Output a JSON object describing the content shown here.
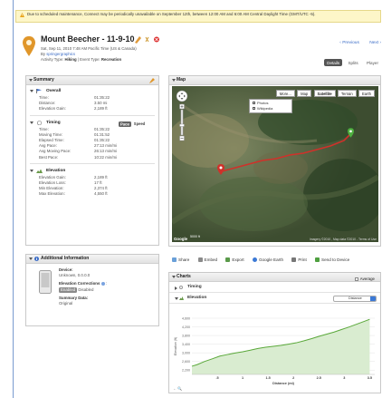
{
  "notice": "Due to scheduled maintenance, Connect may be periodically unavailable on September 12th, between 12:00 AM and 6:00 AM Central Daylight Time (GMT/UTC -5).",
  "activity": {
    "title": "Mount Beecher - 11-9-10",
    "date": "Sat, Sep 11, 2010 7:48 AM Pacific Time (US & Canada)",
    "by_label": "By",
    "by_user": "springergraphics",
    "type_label": "Activity Type:",
    "type_value": "Hiking",
    "event_label": "Event Type:",
    "event_value": "Recreation"
  },
  "nav": {
    "previous": "‹ Previous",
    "next": "Next ›"
  },
  "tabs": [
    "Details",
    "Splits",
    "Player"
  ],
  "summary": {
    "title": "Summary",
    "overall": {
      "title": "Overall",
      "rows": [
        {
          "k": "Time:",
          "v": "01:35:22"
        },
        {
          "k": "Distance:",
          "v": "3.50 mi"
        },
        {
          "k": "Elevation Gain:",
          "v": "2,189 ft"
        }
      ]
    },
    "timing": {
      "title": "Timing",
      "toggle_on": "Pace",
      "toggle_off": "Speed",
      "rows": [
        {
          "k": "Time:",
          "v": "01:35:22"
        },
        {
          "k": "Moving Time:",
          "v": "01:31:52"
        },
        {
          "k": "Elapsed Time:",
          "v": "01:35:22"
        },
        {
          "k": "Avg Pace:",
          "v": "27:13 min/mi"
        },
        {
          "k": "Avg Moving Pace:",
          "v": "26:13 min/mi"
        },
        {
          "k": "Best Pace:",
          "v": "10:22 min/mi"
        }
      ]
    },
    "elevation": {
      "title": "Elevation",
      "rows": [
        {
          "k": "Elevation Gain:",
          "v": "2,189 ft"
        },
        {
          "k": "Elevation Loss:",
          "v": "17 ft"
        },
        {
          "k": "Min Elevation:",
          "v": "2,374 ft"
        },
        {
          "k": "Max Elevation:",
          "v": "4,550 ft"
        }
      ]
    }
  },
  "map": {
    "title": "Map",
    "types": [
      "More...",
      "Map",
      "Satellite",
      "Terrain",
      "Earth"
    ],
    "more_options": [
      "Photos",
      "Wikipedia"
    ],
    "scale": "5000 ft",
    "logo": "Google",
    "attribution": "Imagery ©2010 , Map data ©2010 - Terms of Use"
  },
  "toolbar": [
    "Share",
    "Embed",
    "Export",
    "Google Earth",
    "Print",
    "Send to Device"
  ],
  "additional": {
    "title": "Additional Information",
    "device_label": "Device:",
    "device_value": "Unknown, 0.0.0.0",
    "corrections_label": "Elevation Corrections",
    "enabled": "Enabled",
    "disabled": "Disabled",
    "summary_label": "Summary Data:",
    "summary_value": "Original"
  },
  "charts": {
    "title": "Charts",
    "average": "Average",
    "timing": "Timing",
    "elevation": "Elevation",
    "x_select": "Distance"
  },
  "chart_data": {
    "type": "area",
    "ylabel": "Elevation (ft)",
    "xlabel": "Distance (mi)",
    "x": [
      0,
      0.1,
      0.25,
      0.4,
      0.55,
      0.7,
      0.85,
      1.0,
      1.15,
      1.3,
      1.45,
      1.6,
      1.75,
      1.9,
      2.05,
      2.2,
      2.35,
      2.5,
      2.65,
      2.8,
      2.95,
      3.1,
      3.25,
      3.4,
      3.5
    ],
    "y": [
      2380,
      2450,
      2600,
      2720,
      2850,
      2920,
      2990,
      3050,
      3120,
      3200,
      3260,
      3300,
      3340,
      3400,
      3460,
      3550,
      3650,
      3760,
      3860,
      3960,
      4080,
      4200,
      4330,
      4460,
      4550
    ],
    "xlim": [
      0,
      3.6
    ],
    "ylim": [
      2000,
      4600
    ],
    "xticks": [
      ".5",
      "1",
      "1.5",
      "2",
      "2.5",
      "3",
      "3.5"
    ],
    "xtick_values": [
      0.5,
      1,
      1.5,
      2,
      2.5,
      3,
      3.5
    ],
    "yticks": [
      "4,600",
      "4,200",
      "3,800",
      "3,400",
      "3,000",
      "2,600",
      "2,200"
    ],
    "ytick_values": [
      4600,
      4200,
      3800,
      3400,
      3000,
      2600,
      2200
    ],
    "grid": true,
    "color": "#5aa83a"
  }
}
